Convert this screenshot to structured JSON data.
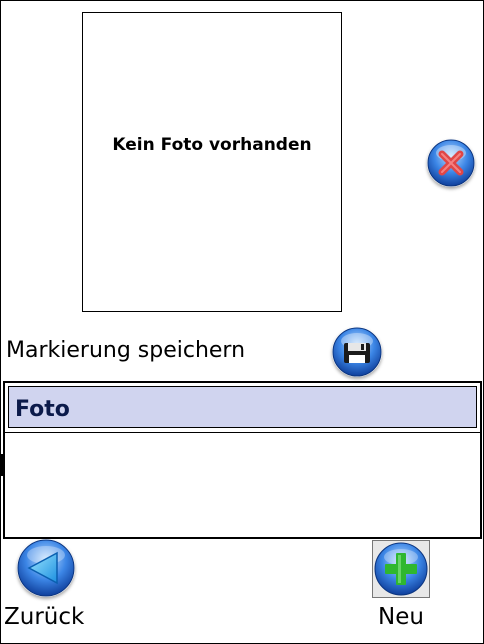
{
  "photo": {
    "placeholder_text": "Kein Foto vorhanden"
  },
  "markierung": {
    "label": "Markierung speichern"
  },
  "list": {
    "header": "Foto"
  },
  "footer": {
    "back_label": "Zurück",
    "new_label": "Neu"
  },
  "colors": {
    "list_header_bg": "#d0d4ef",
    "button_blue": "#1f6fd6",
    "delete_red": "#e04646",
    "add_green": "#2fb72f"
  },
  "icons": {
    "delete": "close-icon",
    "save": "floppy-disk-icon",
    "back": "arrow-left-icon",
    "new": "plus-icon"
  }
}
